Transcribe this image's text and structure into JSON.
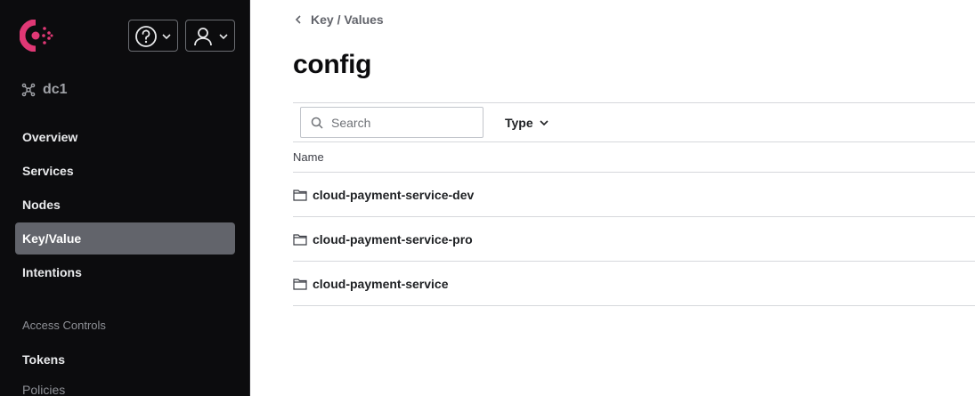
{
  "sidebar": {
    "datacenter": "dc1",
    "nav": [
      {
        "label": "Overview"
      },
      {
        "label": "Services"
      },
      {
        "label": "Nodes"
      },
      {
        "label": "Key/Value",
        "active": true
      },
      {
        "label": "Intentions"
      }
    ],
    "access_section": "Access Controls",
    "access_items": [
      {
        "label": "Tokens"
      },
      {
        "label": "Policies"
      }
    ]
  },
  "breadcrumb": "Key / Values",
  "page_title": "config",
  "filter": {
    "search_placeholder": "Search",
    "type_label": "Type"
  },
  "table": {
    "column_name": "Name",
    "rows": [
      {
        "name": "cloud-payment-service-dev",
        "icon": "folder-icon"
      },
      {
        "name": "cloud-payment-service-pro",
        "icon": "folder-icon"
      },
      {
        "name": "cloud-payment-service",
        "icon": "folder-icon"
      }
    ]
  },
  "colors": {
    "brand": "#e03875",
    "sidebar_bg": "#0c0c0e",
    "active_nav": "#62646b"
  }
}
